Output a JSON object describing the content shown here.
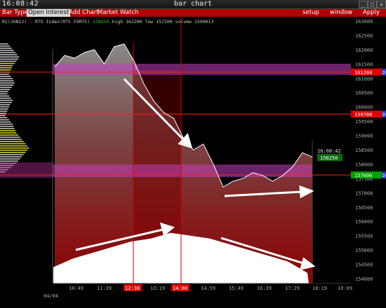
{
  "window": {
    "time": "16:08:42",
    "title": "bar chart",
    "controls": [
      "_",
      "□",
      "×"
    ]
  },
  "menu": {
    "bar_type": "Bar Type",
    "open_interest": "Open Interest",
    "add_chart": "Add Chart",
    "market_watch": "Market Watch",
    "setup": "setup",
    "window": "window",
    "apply": "Apply"
  },
  "instrument": {
    "symbol": "RI(JUN12) - RTS Index(RTS FORTS)",
    "last": "158250",
    "high": "high 162200",
    "low": "low 157200",
    "volume": "volume 1509013"
  },
  "y_axis": [
    "163000",
    "162500",
    "162000",
    "161500",
    "161000",
    "160500",
    "160000",
    "159500",
    "159000",
    "158500",
    "158000",
    "157500",
    "157000",
    "156500",
    "156000",
    "155500",
    "155000",
    "154500",
    "154000"
  ],
  "x_axis": [
    "10:49",
    "11:39",
    "12:30",
    "13:19",
    "14:00",
    "14:59",
    "15:49",
    "16:39",
    "17:29",
    "18:19",
    "19:09"
  ],
  "highlighted_times": [
    "12:30",
    "14:00"
  ],
  "date_label": "04/04",
  "price_tags": {
    "level_high": "161200",
    "level_mid": "159700",
    "level_low": "157600",
    "last_time": "16:08:42",
    "last_price": "158250",
    "side_mark": "D"
  },
  "chart_data": {
    "type": "line",
    "title": "",
    "ylim": [
      153800,
      163200
    ],
    "series": [
      {
        "values": [
          161400,
          161800,
          161700,
          161900,
          162000,
          161500,
          162100,
          162200,
          161600,
          160800,
          160200,
          159800,
          159600,
          158900,
          158500,
          158700,
          158000,
          157200,
          157400,
          157500,
          157700,
          157600,
          157400,
          157600,
          157900,
          158400,
          158250
        ]
      }
    ],
    "volume_profile_bottom": [
      154400,
      154700,
      154900,
      155100,
      155300,
      155400,
      155600,
      155500,
      155400,
      155200,
      155000,
      154800,
      154600,
      154200
    ]
  }
}
